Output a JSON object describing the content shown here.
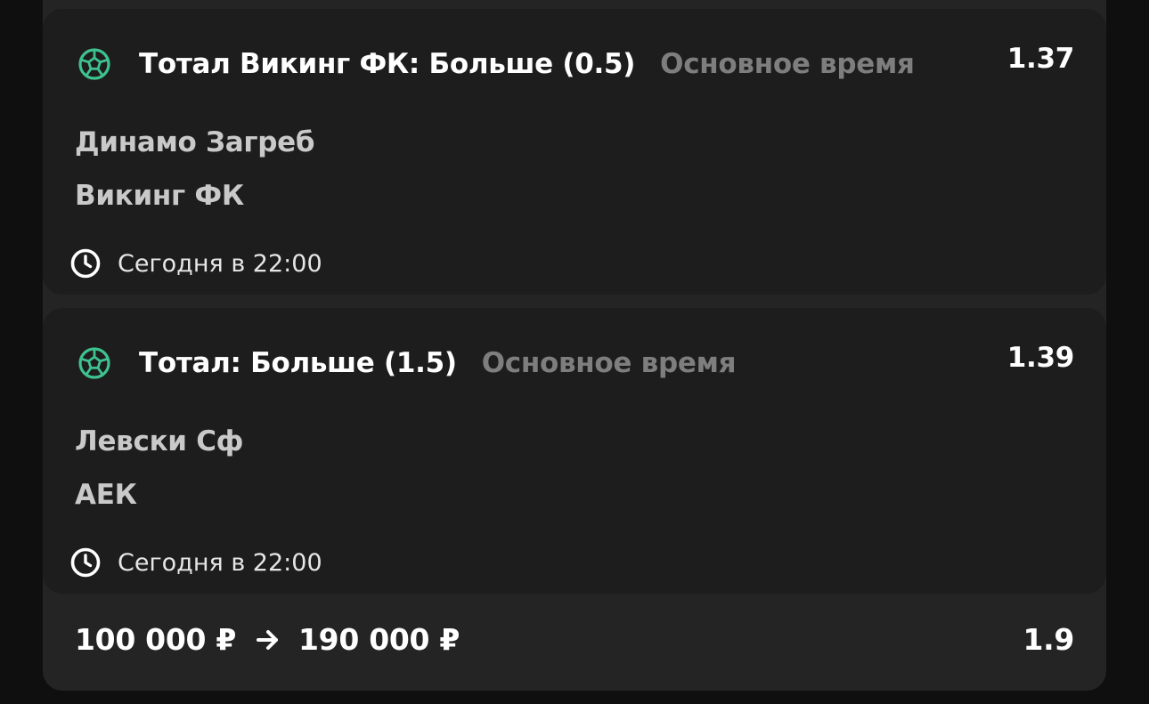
{
  "bets": [
    {
      "market": "Тотал Викинг ФК: Больше (0.5)",
      "period": "Основное время",
      "odds": "1.37",
      "home_team": "Динамо Загреб",
      "away_team": "Викинг ФК",
      "time": "Сегодня в 22:00",
      "sport_icon": "soccer-ball-icon",
      "time_icon": "clock-icon"
    },
    {
      "market": "Тотал: Больше (1.5)",
      "period": "Основное время",
      "odds": "1.39",
      "home_team": "Левски Сф",
      "away_team": "АЕК",
      "time": "Сегодня в 22:00",
      "sport_icon": "soccer-ball-icon",
      "time_icon": "clock-icon"
    }
  ],
  "summary": {
    "stake": "100 000 ₽",
    "payout": "190 000 ₽",
    "total_odds": "1.9",
    "arrow_icon": "arrow-right-icon"
  },
  "colors": {
    "background": "#0f0f0f",
    "card": "#1d1d1d",
    "container": "#242424",
    "accent": "#3ec28f",
    "muted": "#7e7e7e"
  }
}
